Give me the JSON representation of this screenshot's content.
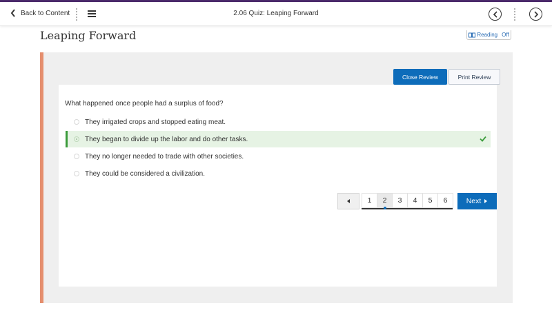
{
  "topbar": {
    "back_label": "Back to Content",
    "title": "2.06 Quiz: Leaping Forward"
  },
  "page": {
    "title": "Leaping Forward",
    "reading_label": "Reading",
    "reading_state": "Off"
  },
  "review": {
    "close_label": "Close Review",
    "print_label": "Print Review"
  },
  "question": {
    "text": "What happened once people had a surplus of food?",
    "options": [
      {
        "label": "They irrigated crops and stopped eating meat.",
        "selected": false
      },
      {
        "label": "They began to divide up the labor and do other tasks.",
        "selected": true,
        "correct": true
      },
      {
        "label": "They no longer needed to trade with other societies.",
        "selected": false
      },
      {
        "label": "They could be considered a civilization.",
        "selected": false
      }
    ]
  },
  "pagination": {
    "pages": [
      "1",
      "2",
      "3",
      "4",
      "5",
      "6"
    ],
    "current": "2",
    "next_label": "Next"
  },
  "colors": {
    "primary": "#0d6cba",
    "accent_border": "#e58e6e",
    "correct": "#3a9b3a",
    "correct_bg": "#e6f3e4",
    "topbar_border": "#4b2a6b"
  }
}
